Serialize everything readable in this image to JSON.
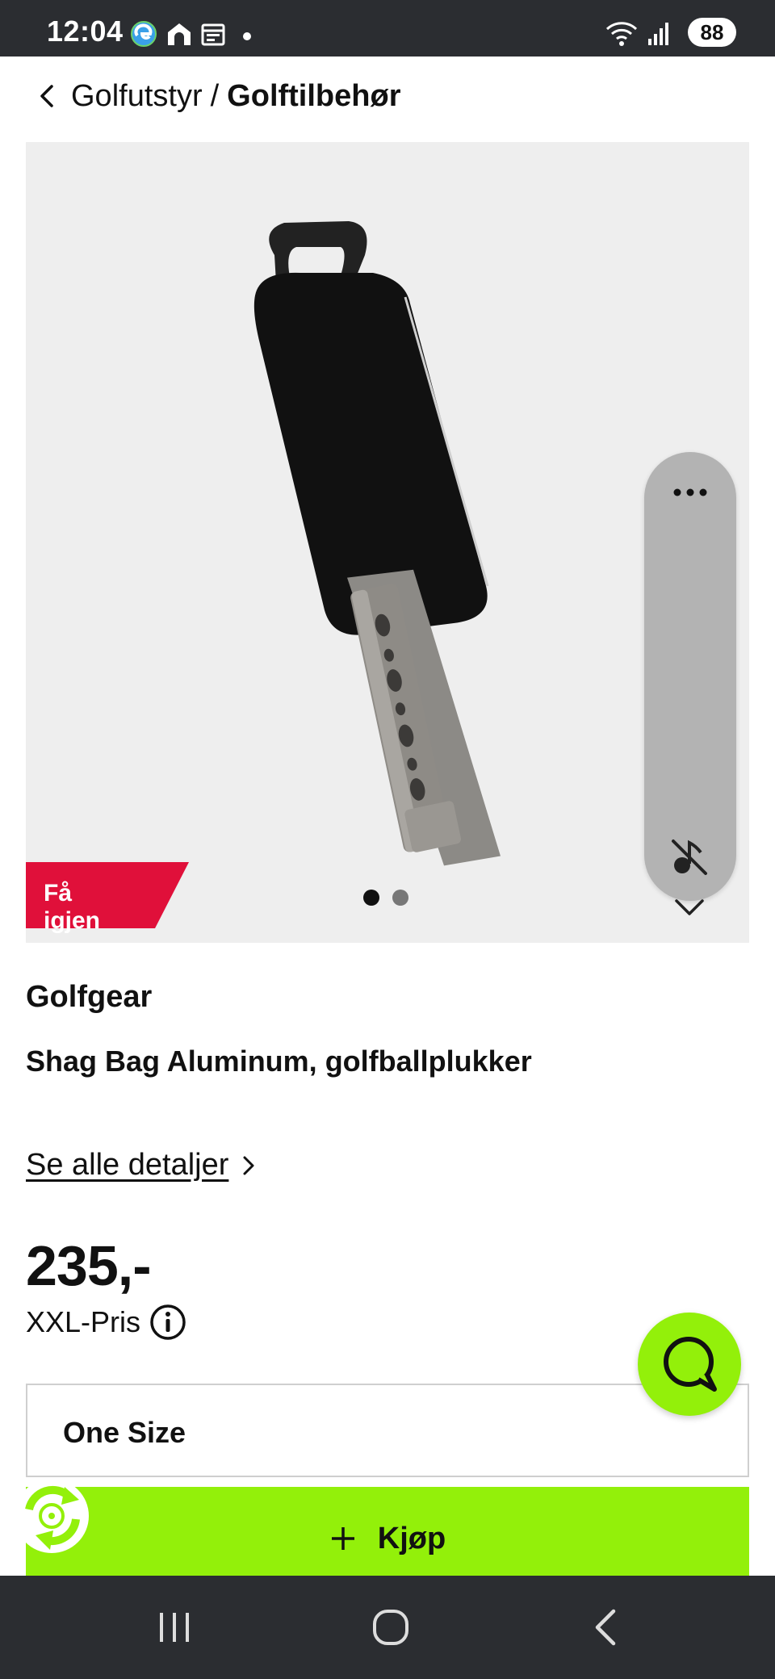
{
  "status_bar": {
    "time": "12:04",
    "battery": "88",
    "left_icons": [
      "edge-browser-icon",
      "home-app-icon",
      "calendar-icon"
    ],
    "right_icons": [
      "wifi-icon",
      "signal-icon"
    ]
  },
  "breadcrumb": {
    "back_icon": "chevron-left-icon",
    "parent": "Golfutstyr",
    "separator": "/",
    "current": "Golftilbehør"
  },
  "gallery": {
    "badge": "Få igjen",
    "badge_color": "#e0103a",
    "page_count": 2,
    "active_page": 1,
    "overlay_icons": [
      "more-icon",
      "mute-icon",
      "chevron-down-icon"
    ]
  },
  "product": {
    "brand": "Golfgear",
    "name": "Shag Bag Aluminum, golfballplukker",
    "details_link": "Se alle detaljer",
    "price": "235,-",
    "price_label": "XXL-Pris",
    "size": "One Size",
    "buy_label": "Kjøp"
  },
  "colors": {
    "accent": "#93f00a",
    "badge": "#e0103a",
    "system_bar": "#2b2d31"
  },
  "nav_bar": {
    "buttons": [
      "recent-apps-icon",
      "home-icon",
      "back-icon"
    ]
  }
}
